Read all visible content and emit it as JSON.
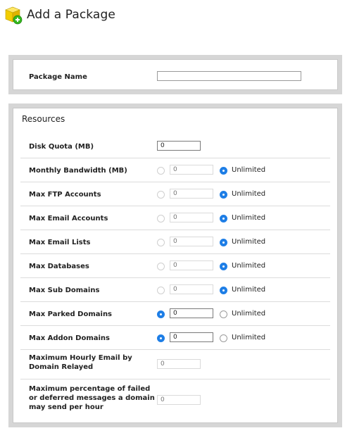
{
  "header": {
    "title": "Add a Package"
  },
  "package_name": {
    "label": "Package Name",
    "value": ""
  },
  "resources": {
    "title": "Resources",
    "disk_quota": {
      "label": "Disk Quota (MB)",
      "value": "0"
    },
    "rows": [
      {
        "label": "Monthly Bandwidth (MB)",
        "value": "0",
        "unlimited_label": "Unlimited",
        "unlimited": true
      },
      {
        "label": "Max FTP Accounts",
        "value": "0",
        "unlimited_label": "Unlimited",
        "unlimited": true
      },
      {
        "label": "Max Email Accounts",
        "value": "0",
        "unlimited_label": "Unlimited",
        "unlimited": true
      },
      {
        "label": "Max Email Lists",
        "value": "0",
        "unlimited_label": "Unlimited",
        "unlimited": true
      },
      {
        "label": "Max Databases",
        "value": "0",
        "unlimited_label": "Unlimited",
        "unlimited": true
      },
      {
        "label": "Max Sub Domains",
        "value": "0",
        "unlimited_label": "Unlimited",
        "unlimited": true
      },
      {
        "label": "Max Parked Domains",
        "value": "0",
        "unlimited_label": "Unlimited",
        "unlimited": false
      },
      {
        "label": "Max Addon Domains",
        "value": "0",
        "unlimited_label": "Unlimited",
        "unlimited": false
      }
    ],
    "hourly_email": {
      "label_line1": "Maximum Hourly Email by",
      "label_line2": "Domain Relayed",
      "placeholder": "0"
    },
    "failed_pct": {
      "label_line1": "Maximum percentage of failed",
      "label_line2": "or deferred messages a domain",
      "label_line3": "may send per hour",
      "placeholder": "0"
    }
  },
  "colors": {
    "radio_selected": "#1e7ee6",
    "frame_gray": "#d6d6d6"
  },
  "icons": {
    "header_icon": "package-add-icon"
  }
}
